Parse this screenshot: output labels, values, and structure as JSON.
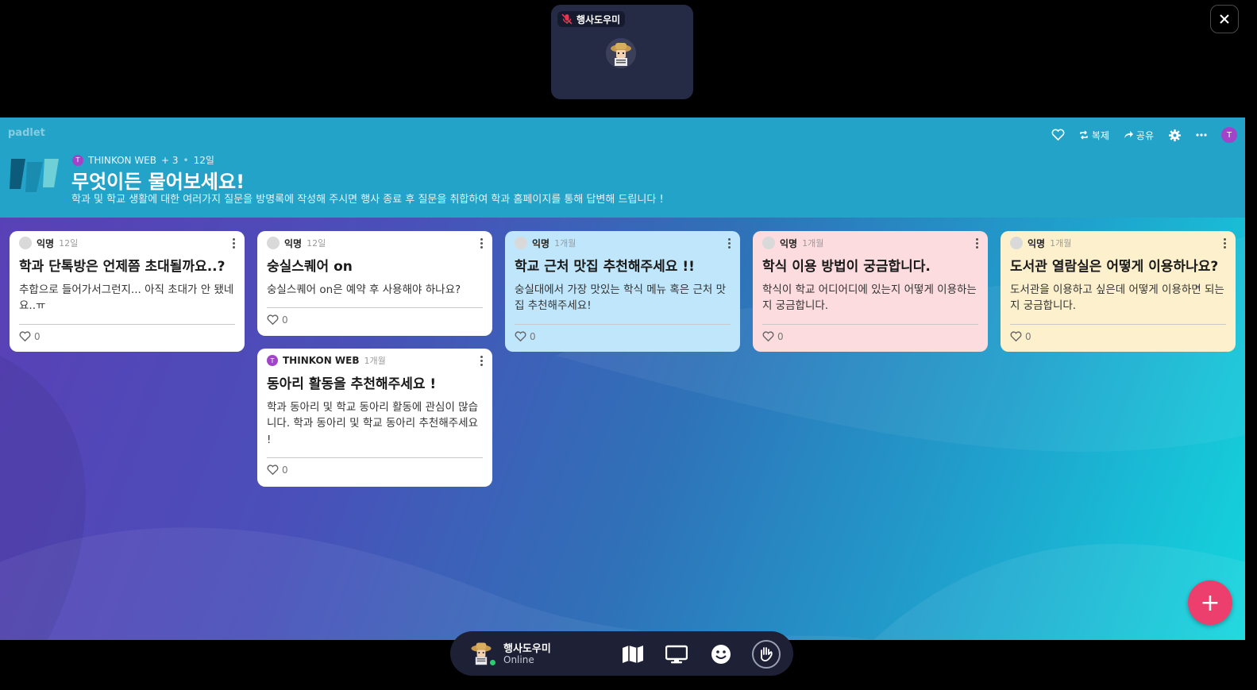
{
  "video": {
    "name": "행사도우미",
    "muted": true
  },
  "padlet": {
    "brand": "padlet",
    "author": "THINKON WEB",
    "author_initial": "T",
    "contributors": "+ 3",
    "age": "12일",
    "title": "무엇이든 물어보세요!",
    "description": "학과 및 학교 생활에 대한 여러가지 질문을 방명록에 작성해 주시면 행사 종료 후 질문을 취합하여 학과 홈페이지를 통해 답변해 드립니다 !",
    "actions": {
      "like_icon": "heart-icon",
      "remake": "복제",
      "share": "공유",
      "settings_icon": "gear-icon",
      "more_icon": "more-icon",
      "user_initial": "T"
    }
  },
  "posts": [
    {
      "author": "익명",
      "time": "12일",
      "title": "학과 단톡방은 언제쯤 초대될까요..?",
      "body": "추합으로 들어가서그런지... 아직 초대가 안 됐네요..ㅠ",
      "likes": "0",
      "color": "#ffffff"
    },
    {
      "author": "익명",
      "time": "12일",
      "title": "숭실스퀘어 on",
      "body": "숭실스퀘어 on은 예약 후 사용해야 하나요?",
      "likes": "0",
      "color": "#ffffff"
    },
    {
      "author": "THINKON WEB",
      "author_initial": "T",
      "time": "1개월",
      "title": "동아리 활동을 추천해주세요 !",
      "body": "학과 동아리 및 학교 동아리 활동에 관심이 많습니다. 학과 동아리 및 학교 동아리 추천해주세요 !",
      "likes": "0",
      "color": "#ffffff"
    },
    {
      "author": "익명",
      "time": "1개월",
      "title": "학교 근처 맛집 추천해주세요 !!",
      "body": "숭실대에서 가장 맛있는 학식 메뉴 혹은 근처 맛집 추천해주세요!",
      "likes": "0",
      "color": "#bfe6fb"
    },
    {
      "author": "익명",
      "time": "1개월",
      "title": "학식 이용 방법이 궁금합니다.",
      "body": "학식이 학교 어디어디에 있는지 어떻게 이용하는지 궁금합니다.",
      "likes": "0",
      "color": "#fcdcdf"
    },
    {
      "author": "익명",
      "time": "1개월",
      "title": "도서관 열람실은 어떻게 이용하나요?",
      "body": "도서관을 이용하고 싶은데 어떻게 이용하면 되는지 궁금합니다.",
      "likes": "0",
      "color": "#fdf1cd"
    }
  ],
  "dock": {
    "name": "행사도우미",
    "status": "Online",
    "icons": [
      "map-icon",
      "screen-share-icon",
      "emoji-icon",
      "wave-hand-icon"
    ]
  },
  "fab_label": "+"
}
